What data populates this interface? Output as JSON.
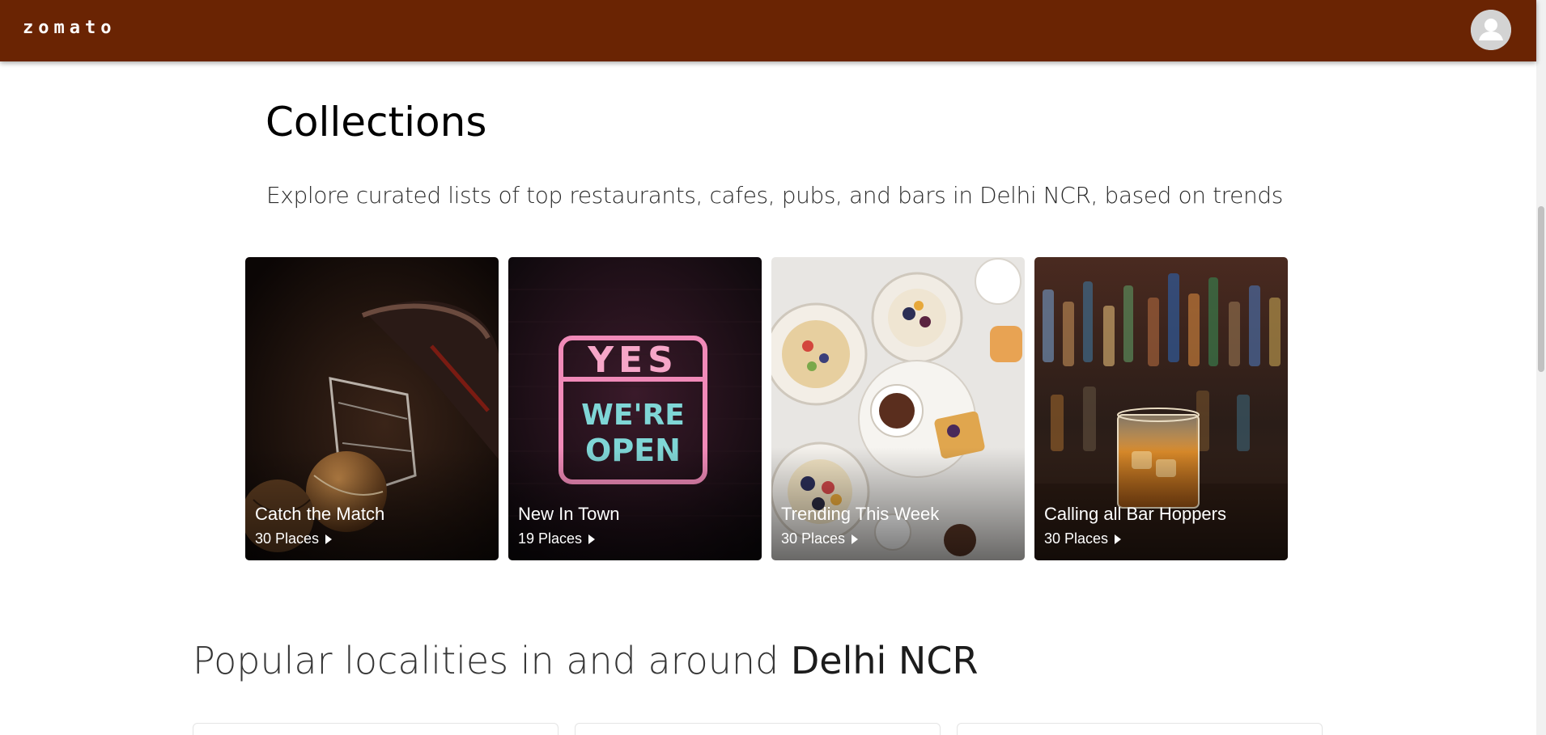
{
  "header": {
    "logo": "zomato",
    "avatar_icon": "user-avatar-icon",
    "bg_color": "#6a2403"
  },
  "collections": {
    "title": "Collections",
    "subtitle": "Explore curated lists of top restaurants, cafes, pubs, and bars in Delhi NCR, based on trends",
    "cards": [
      {
        "title": "Catch the Match",
        "places": "30 Places"
      },
      {
        "title": "New In Town",
        "places": "19 Places",
        "sign_top": "YES",
        "sign_mid": "WE'RE",
        "sign_bot": "OPEN"
      },
      {
        "title": "Trending This Week",
        "places": "30 Places"
      },
      {
        "title": "Calling all Bar Hoppers",
        "places": "30 Places"
      }
    ]
  },
  "localities": {
    "title_prefix": "Popular localities in and around ",
    "title_city": "Delhi NCR"
  }
}
